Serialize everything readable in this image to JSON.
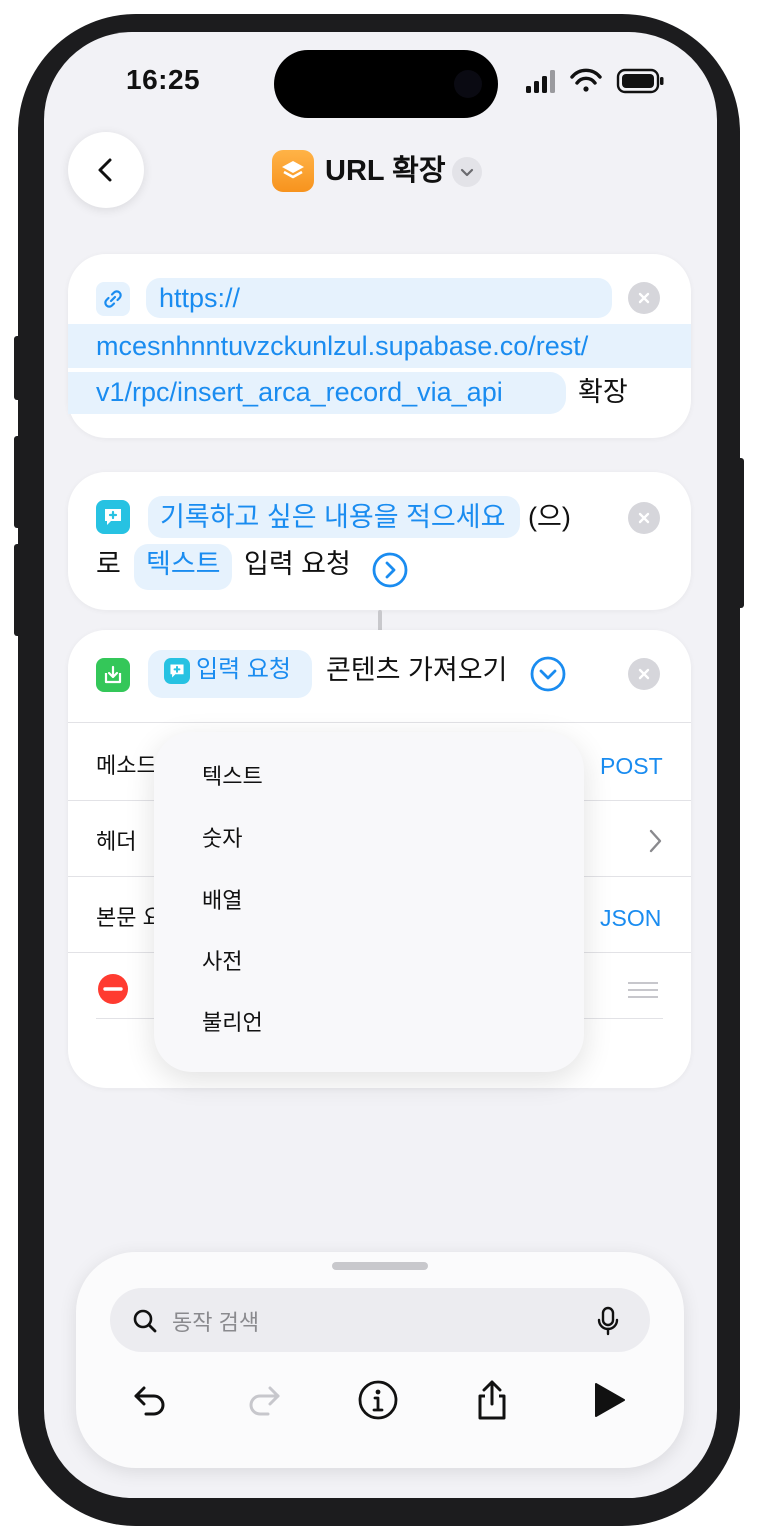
{
  "status": {
    "time": "16:25"
  },
  "header": {
    "title": "URL 확장"
  },
  "url_card": {
    "line1": "https://",
    "line2": "mcesnhnntuvzckunlzul.supabase.co/rest/",
    "line3": "v1/rpc/insert_arca_record_via_api",
    "suffix": "확장"
  },
  "ask_card": {
    "prompt": "기록하고 싶은 내용을 적으세요",
    "particle": "(으)",
    "ro": "로",
    "type_token": "텍스트",
    "action": "입력 요청"
  },
  "fetch_card": {
    "input_token": "입력 요청",
    "action": "콘텐츠 가져오기",
    "rows": [
      {
        "label": "메소드",
        "value": "POST"
      },
      {
        "label": "헤더",
        "value": ""
      },
      {
        "label": "본문 요",
        "value": "JSON"
      }
    ]
  },
  "type_menu": {
    "items": [
      "텍스트",
      "숫자",
      "배열",
      "사전",
      "불리언"
    ]
  },
  "bottom": {
    "search_placeholder": "동작 검색"
  },
  "colors": {
    "accent": "#1a8cf0",
    "background": "#f2f2f6",
    "remove": "#ff3b30",
    "url_icon_bg": "#e6f2fd",
    "ask_icon": "#27c2e2",
    "fetch_icon": "#34c759"
  }
}
